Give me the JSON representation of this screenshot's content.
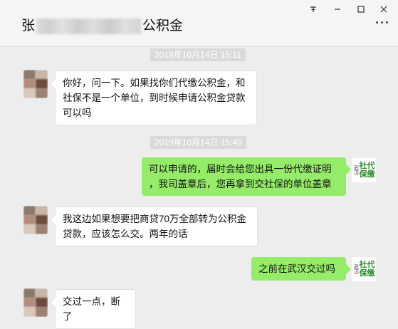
{
  "header": {
    "title_prefix": "张",
    "title_suffix": "公积金",
    "pin_icon": "pin-icon",
    "min_icon": "minimize-icon",
    "max_icon": "maximize-icon",
    "close_icon": "close-icon",
    "more_icon": "more-dots-icon"
  },
  "messages": {
    "ts1": "2019年10月14日 15:11",
    "m1": [
      "你好，问一下。如果找你们代缴公积金，和",
      "社保不是一个单位，到时候申请公积金贷款",
      "可以吗"
    ],
    "ts2": "2019年10月14日 15:48",
    "m2": [
      "可以申请的，届时会给您出具一份代缴证明",
      "，我司盖章后，您再拿到交社保的单位盖章"
    ],
    "m3": [
      "我这边如果想要把商贷70万全部转为公积金",
      "贷款，应该怎么交。两年的话"
    ],
    "m4": "之前在武汉交过吗",
    "m5": "交过一点，断了"
  },
  "logo": {
    "small_text": "武汉",
    "big_line1": "社代",
    "big_line2": "保缴",
    "color": "#2c8a2c"
  },
  "colors": {
    "outgoing_bubble": "#95ec69",
    "incoming_bubble": "#ffffff",
    "background": "#ededed"
  }
}
